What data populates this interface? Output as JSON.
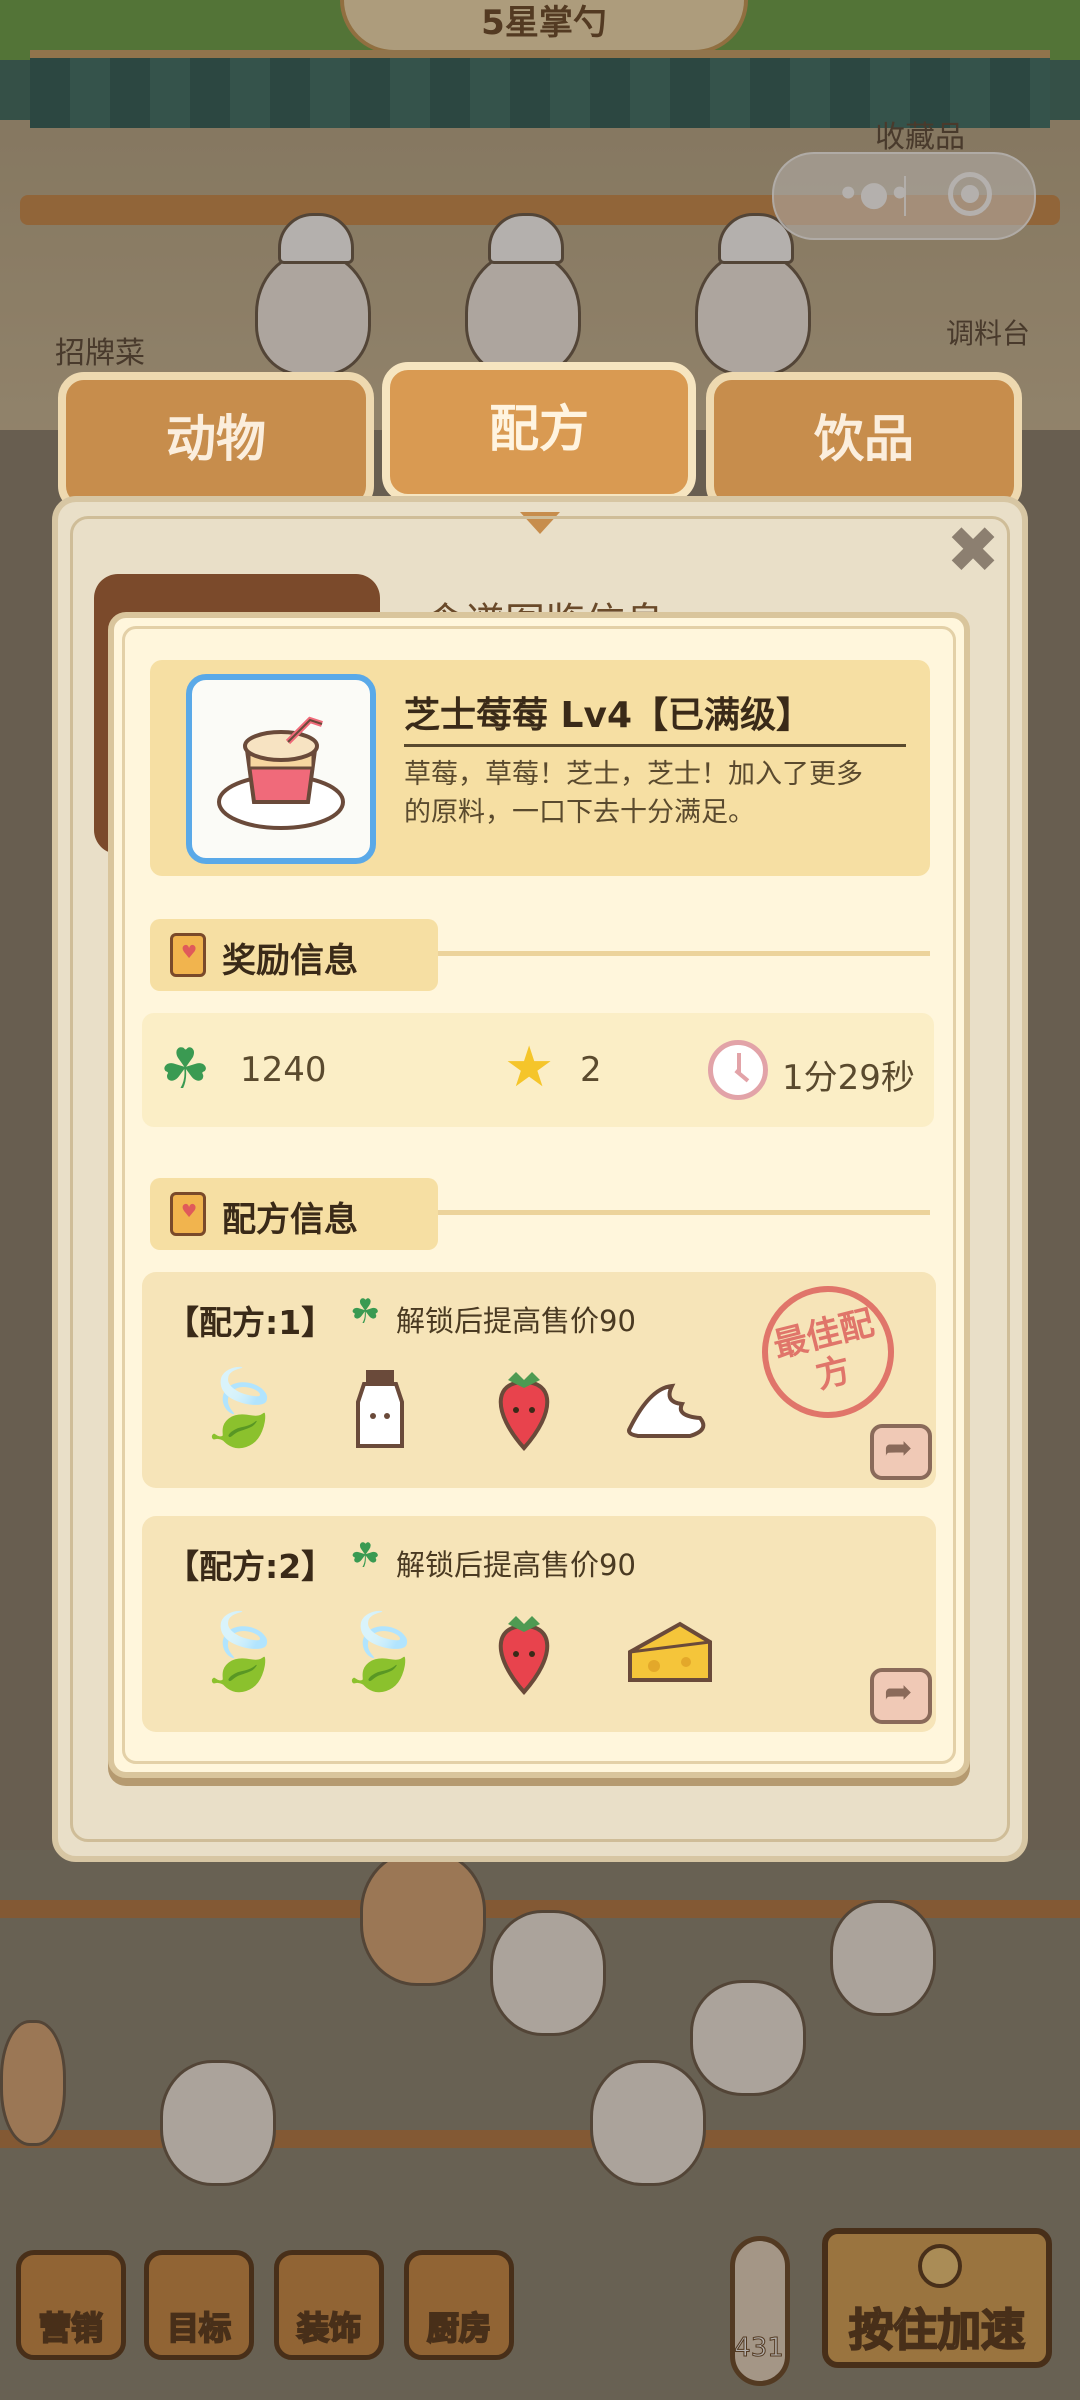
{
  "scene": {
    "top_sign": "5星掌勺",
    "label_collectibles": "收藏品",
    "label_signature": "招牌菜",
    "label_seasoning": "调料台",
    "thermometer_value": "431",
    "speed_button": "按住加速",
    "toolbar": [
      "营销",
      "目标",
      "装饰",
      "厨房"
    ]
  },
  "tabs": [
    {
      "label": "动物"
    },
    {
      "label": "配方"
    },
    {
      "label": "饮品"
    }
  ],
  "panel": {
    "background_title": "食谱图鉴信息"
  },
  "item": {
    "name": "芝士莓莓 Lv4【已满级】",
    "description": "草莓，草莓！芝士，芝士！加入了更多的原料，一口下去十分满足。",
    "icon": "cheese-strawberry-cup-icon"
  },
  "reward_section": {
    "title": "奖励信息",
    "clover_value": "1240",
    "star_value": "2",
    "time_value": "1分29秒"
  },
  "recipe_section": {
    "title": "配方信息",
    "recipes": [
      {
        "title": "【配方:1】",
        "unlock_text": "解锁后提高售价90",
        "ingredients": [
          "tea-leaf-icon",
          "milk-bottle-icon",
          "strawberry-icon",
          "whipped-cream-icon"
        ],
        "best_stamp": "最佳配方"
      },
      {
        "title": "【配方:2】",
        "unlock_text": "解锁后提高售价90",
        "ingredients": [
          "tea-leaf-icon",
          "tea-leaf-icon",
          "strawberry-icon",
          "cheese-icon"
        ]
      }
    ]
  },
  "colors": {
    "tab_brown": "#c78d4c",
    "panel_cream": "#fff6dc",
    "section_tag": "#f6dfa3",
    "thumb_border": "#5aa9e8",
    "stamp_red": "#e0756a"
  }
}
